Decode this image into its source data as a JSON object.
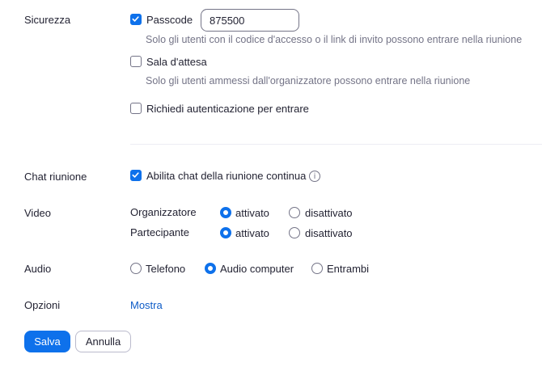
{
  "security": {
    "label": "Sicurezza",
    "passcode": {
      "label": "Passcode",
      "checked": true,
      "value": "875500",
      "help": "Solo gli utenti con il codice d'accesso o il link di invito possono entrare nella riunione"
    },
    "waiting_room": {
      "label": "Sala d'attesa",
      "checked": false,
      "help": "Solo gli utenti ammessi dall'organizzatore possono entrare nella riunione"
    },
    "auth": {
      "label": "Richiedi autenticazione per entrare",
      "checked": false
    }
  },
  "chat": {
    "label": "Chat riunione",
    "option_label": "Abilita chat della riunione continua",
    "checked": true,
    "info_icon": "info-icon"
  },
  "video": {
    "label": "Video",
    "host": {
      "label": "Organizzatore",
      "on_label": "attivato",
      "off_label": "disattivato",
      "selected": "on"
    },
    "participant": {
      "label": "Partecipante",
      "on_label": "attivato",
      "off_label": "disattivato",
      "selected": "on"
    }
  },
  "audio": {
    "label": "Audio",
    "options": [
      "Telefono",
      "Audio computer",
      "Entrambi"
    ],
    "selected": "Audio computer"
  },
  "options": {
    "label": "Opzioni",
    "show_link": "Mostra"
  },
  "buttons": {
    "save": "Salva",
    "cancel": "Annulla"
  },
  "colors": {
    "accent": "#0e71eb",
    "link": "#0e5cc7",
    "text": "#232333",
    "muted": "#747487"
  }
}
